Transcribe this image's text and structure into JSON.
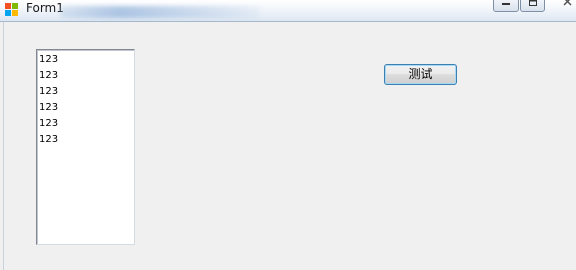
{
  "window": {
    "title": "Form1",
    "icon": "winforms-app-icon",
    "caption_buttons": {
      "minimize_icon": "minimize-icon",
      "maximize_icon": "maximize-icon",
      "close_icon": "close-icon"
    }
  },
  "listbox": {
    "items": [
      "123",
      "123",
      "123",
      "123",
      "123",
      "123"
    ]
  },
  "test_button": {
    "label": "测试"
  },
  "colors": {
    "client_background": "#f0f0f0",
    "listbox_background": "#ffffff",
    "button_border_focus": "#3c7fb1"
  }
}
